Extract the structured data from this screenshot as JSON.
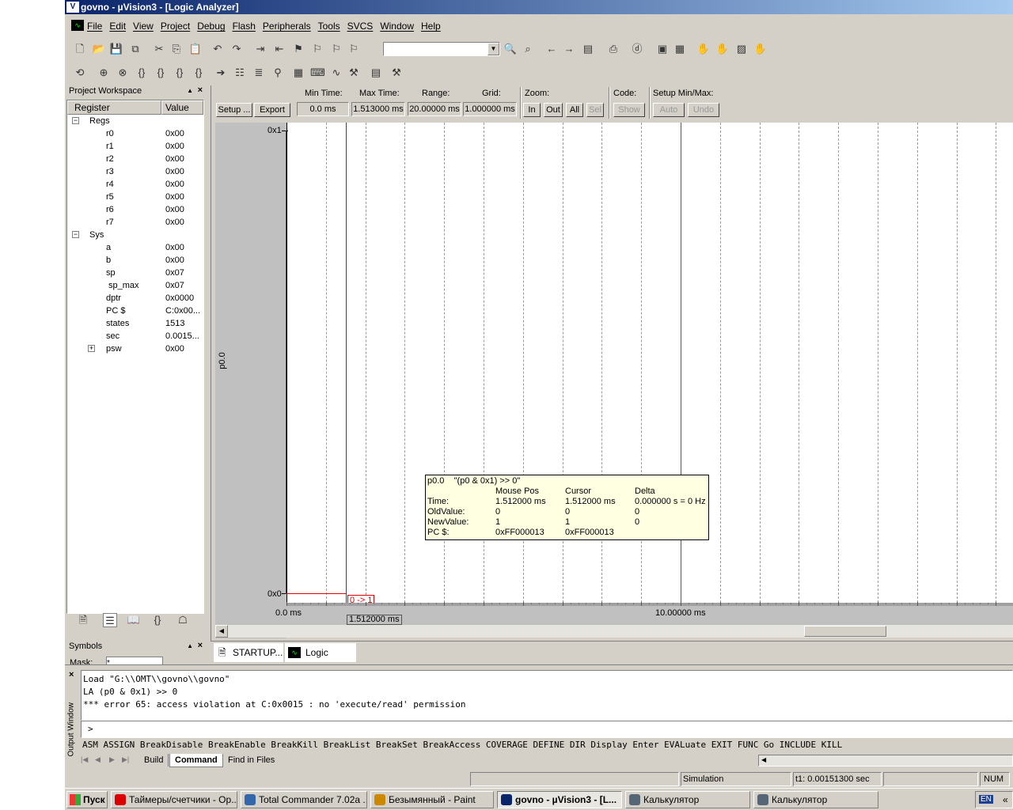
{
  "titlebar": {
    "title": "govno  - µVision3 - [Logic Analyzer]",
    "bg": "#0a246a"
  },
  "menu": [
    "File",
    "Edit",
    "View",
    "Project",
    "Debug",
    "Flash",
    "Peripherals",
    "Tools",
    "SVCS",
    "Window",
    "Help"
  ],
  "toolbar1": {
    "icons": [
      "new-file-icon",
      "open-folder-icon",
      "save-icon",
      "save-all-icon",
      "cut-icon",
      "copy-icon",
      "paste-icon",
      "undo-icon",
      "redo-icon",
      "indent-icon",
      "outdent-icon",
      "bookmark-toggle-icon",
      "bookmark-prev-icon",
      "bookmark-next-icon",
      "bookmark-clear-icon"
    ],
    "combo_value": "",
    "icons2": [
      "find-icon",
      "find-in-files-icon",
      "back-icon",
      "forward-icon",
      "browse-icon",
      "print-icon",
      "debug-session-icon",
      "window-icon",
      "view-icon",
      "hand1-icon",
      "hand2-icon",
      "hand3-icon",
      "hand4-icon"
    ]
  },
  "toolbar2": {
    "icons": [
      "reset-icon",
      "run-icon",
      "stop-icon",
      "step-into-icon",
      "step-over-icon",
      "step-out-icon",
      "run-to-cursor-icon",
      "show-next-icon",
      "disassembly-icon",
      "code-icon",
      "watch-icon",
      "memory-icon",
      "serial-icon",
      "logic-analyzer-icon",
      "toolbox-icon",
      "perf-icon",
      "hammer-icon"
    ]
  },
  "workspace": {
    "title": "Project Workspace",
    "columns": [
      "Register",
      "Value"
    ],
    "groups": [
      {
        "name": "Regs",
        "rows": [
          {
            "name": "r0",
            "value": "0x00"
          },
          {
            "name": "r1",
            "value": "0x00"
          },
          {
            "name": "r2",
            "value": "0x00"
          },
          {
            "name": "r3",
            "value": "0x00"
          },
          {
            "name": "r4",
            "value": "0x00"
          },
          {
            "name": "r5",
            "value": "0x00"
          },
          {
            "name": "r6",
            "value": "0x00"
          },
          {
            "name": "r7",
            "value": "0x00"
          }
        ]
      },
      {
        "name": "Sys",
        "rows": [
          {
            "name": "a",
            "value": "0x00"
          },
          {
            "name": "b",
            "value": "0x00"
          },
          {
            "name": "sp",
            "value": "0x07"
          },
          {
            "name": "sp_max",
            "value": "0x07"
          },
          {
            "name": "dptr",
            "value": "0x0000"
          },
          {
            "name": "PC  $",
            "value": "C:0x00..."
          },
          {
            "name": "states",
            "value": "1513"
          },
          {
            "name": "sec",
            "value": "0.0015..."
          },
          {
            "name": "psw",
            "value": "0x00"
          }
        ]
      }
    ]
  },
  "symbols": {
    "title": "Symbols",
    "mask_label": "Mask:",
    "mask_value": "*"
  },
  "la": {
    "setup_label": "Setup ...",
    "export_label": "Export ...",
    "min_time_label": "Min Time:",
    "min_time": "0.0 ms",
    "max_time_label": "Max Time:",
    "max_time": "1.513000 ms",
    "range_label": "Range:",
    "range": "20.00000 ms",
    "grid_label": "Grid:",
    "grid": "1.000000 ms",
    "zoom_label": "Zoom:",
    "zoom_in": "In",
    "zoom_out": "Out",
    "zoom_all": "All",
    "zoom_sel": "Sel",
    "code_label": "Code:",
    "code_show": "Show",
    "setup_minmax_label": "Setup Min/Max:",
    "auto": "Auto",
    "undo": "Undo",
    "signal": "p0.0",
    "ymax": "0x1",
    "ymin": "0x0",
    "x_start": "0.0 ms",
    "x_mid": "10.00000 ms",
    "cursor_time": "1.512000 ms",
    "transition": "0 -> 1",
    "tooltip": {
      "header": "p0.0    \"(p0 & 0x1) >> 0\"",
      "cols": [
        "",
        "Mouse Pos",
        "Cursor",
        "Delta"
      ],
      "rows": [
        [
          "Time:",
          "1.512000 ms",
          "1.512000 ms",
          "0.000000 s = 0 Hz"
        ],
        [
          "OldValue:",
          "0",
          "0",
          "0"
        ],
        [
          "NewValue:",
          "1",
          "1",
          "0"
        ],
        [
          "PC $:",
          "0xFF000013",
          "0xFF000013",
          ""
        ]
      ]
    }
  },
  "tabs": [
    {
      "label": "STARTUP..."
    },
    {
      "label": "Logic Anal..."
    }
  ],
  "output": {
    "side_label": "Output Window",
    "lines": [
      "Load \"G:\\\\OMT\\\\govno\\\\govno\"",
      "LA (p0 & 0x1) >> 0",
      "*** error 65: access violation at C:0x0015 : no 'execute/read' permission"
    ],
    "prompt": ">",
    "commands": "ASM ASSIGN BreakDisable BreakEnable BreakKill BreakList BreakSet BreakAccess COVERAGE DEFINE DIR Display Enter EVALuate EXIT FUNC Go INCLUDE KILL",
    "tabs": [
      "Build",
      "Command",
      "Find in Files"
    ]
  },
  "status": {
    "mode": "Simulation",
    "time": "t1: 0.00151300 sec",
    "num": "NUM"
  },
  "taskbar": {
    "start": "Пуск",
    "items": [
      "Таймеры/счетчики - Op...",
      "Total Commander 7.02a ...",
      "Безымянный - Paint",
      "govno  - µVision3 - [L...",
      "Калькулятор",
      "Калькулятор"
    ],
    "lang": "EN",
    "more": "«"
  }
}
